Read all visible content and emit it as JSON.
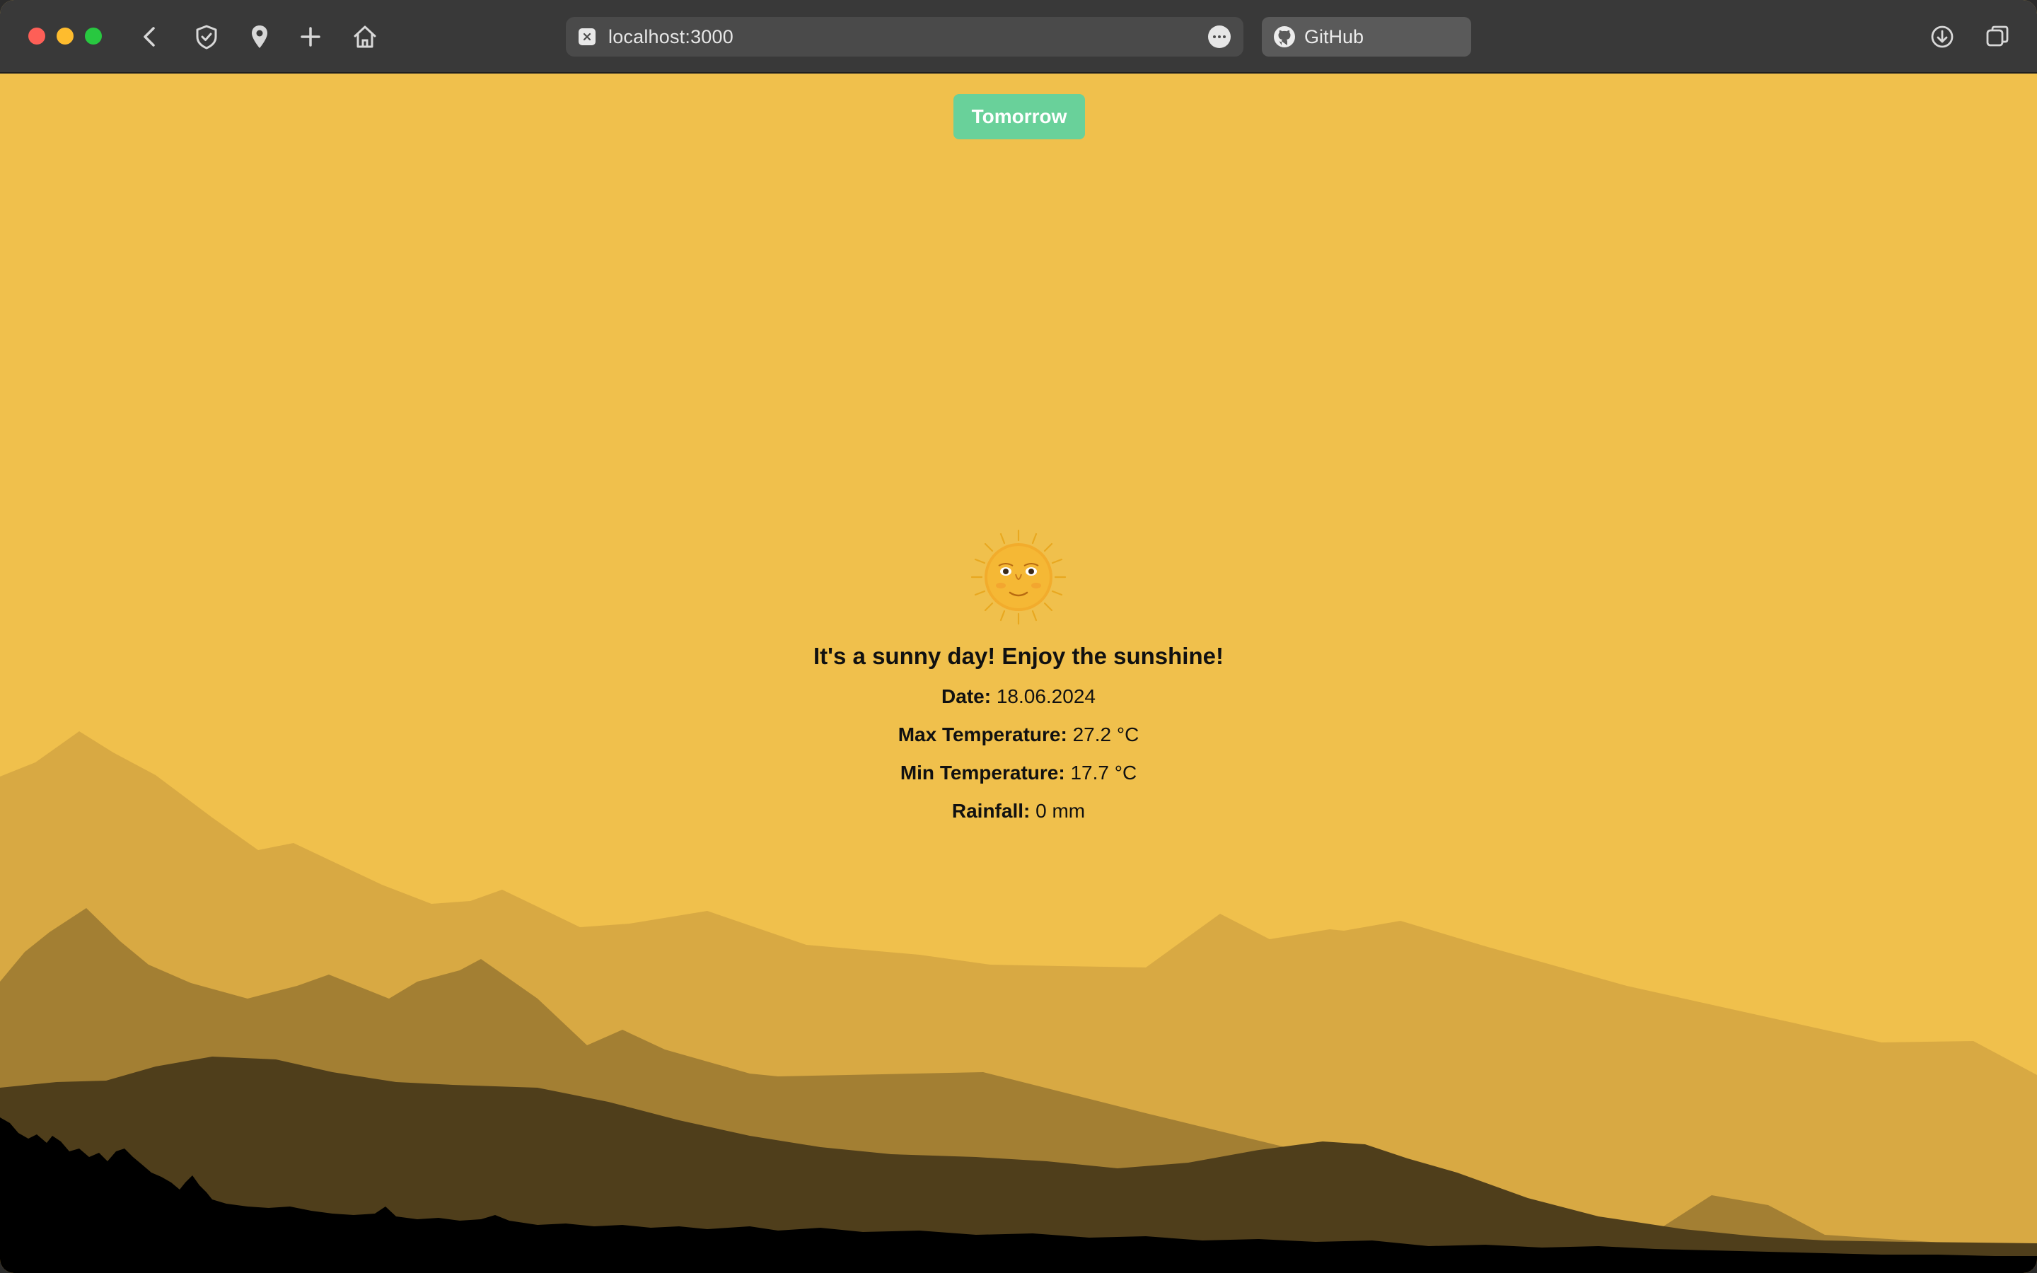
{
  "browser": {
    "url": "localhost:3000",
    "tab_label": "GitHub",
    "icons": [
      "back-icon",
      "shield-icon",
      "location-pin-icon",
      "plus-icon",
      "home-icon",
      "more-icon",
      "github-icon",
      "download-icon",
      "tabs-overview-icon"
    ]
  },
  "page": {
    "nav_button": "Tomorrow",
    "weather_icon": "sun-with-face-icon",
    "headline": "It's a sunny day! Enjoy the sunshine!",
    "rows": [
      {
        "label": "Date:",
        "value": "18.06.2024"
      },
      {
        "label": "Max Temperature:",
        "value": "27.2 °C"
      },
      {
        "label": "Min Temperature:",
        "value": "17.7 °C"
      },
      {
        "label": "Rainfall:",
        "value": "0 mm"
      }
    ]
  },
  "colors": {
    "background": "#f0c04c",
    "button": "#69d19a",
    "mountain_1": "#d8a943",
    "mountain_2": "#a37f33",
    "mountain_3": "#4f3e1b",
    "ground": "#000000"
  }
}
